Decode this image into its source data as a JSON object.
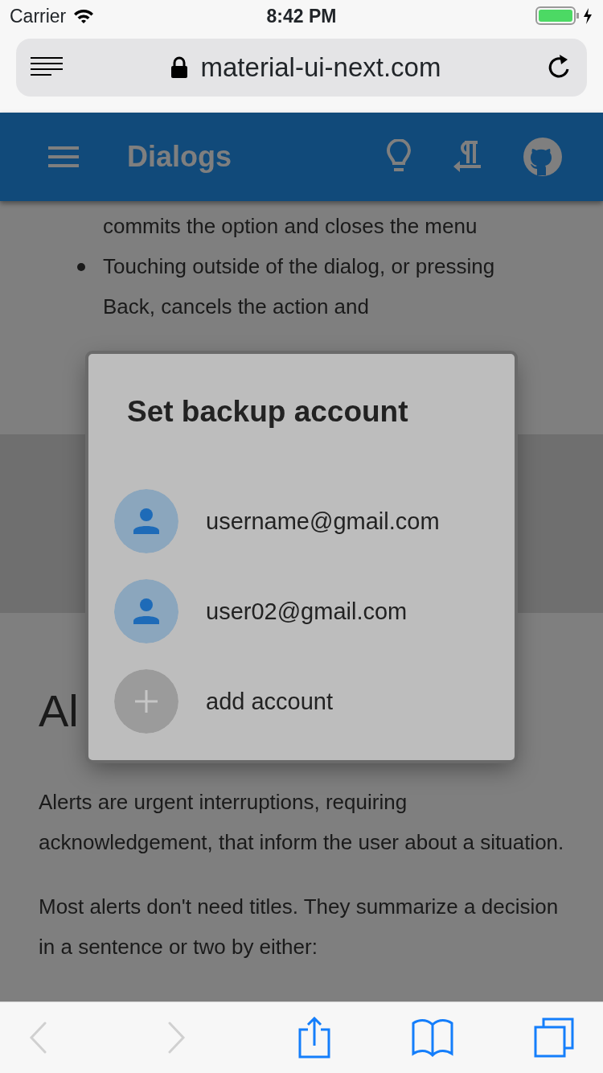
{
  "status_bar": {
    "carrier": "Carrier",
    "time": "8:42 PM"
  },
  "address_bar": {
    "url": "material-ui-next.com"
  },
  "app_bar": {
    "title": "Dialogs"
  },
  "page": {
    "bullets": [
      "commits the option and closes the menu",
      "Touching outside of the dialog, or pressing Back, cancels the action and"
    ],
    "heading": "Al",
    "paragraphs": [
      "Alerts are urgent interruptions, requiring acknowledgement, that inform the user about a situation.",
      "Most alerts don't need titles. They summarize a decision in a sentence or two by either:"
    ]
  },
  "dialog": {
    "title": "Set backup account",
    "items": [
      {
        "kind": "account",
        "label": "username@gmail.com"
      },
      {
        "kind": "account",
        "label": "user02@gmail.com"
      },
      {
        "kind": "add",
        "label": "add account"
      }
    ]
  },
  "toolbar": {
    "back_disabled": true,
    "forward_disabled": true
  }
}
